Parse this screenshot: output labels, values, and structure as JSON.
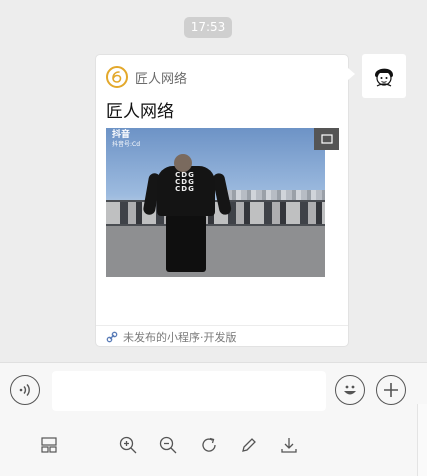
{
  "chat": {
    "timestamp": "17:53"
  },
  "card": {
    "brand_name": "匠人网络",
    "title": "匠人网络",
    "video_watermark": "抖音",
    "video_watermark_sub": "抖音号:Cd",
    "shirt_text": "CDG\nCDG\nCDG",
    "footer_text": "未发布的小程序·开发版"
  },
  "input_bar": {
    "voice_icon": "voice-icon",
    "emoji_icon": "emoji-icon",
    "plus_icon": "plus-icon",
    "message_value": ""
  },
  "toolbar": {
    "items": [
      "layout-icon",
      "zoom-in-icon",
      "zoom-out-icon",
      "rotate-icon",
      "edit-icon",
      "download-icon"
    ]
  },
  "colors": {
    "background": "#ededed",
    "logo_accent": "#e3a82b",
    "link_accent": "#5b7db8"
  }
}
